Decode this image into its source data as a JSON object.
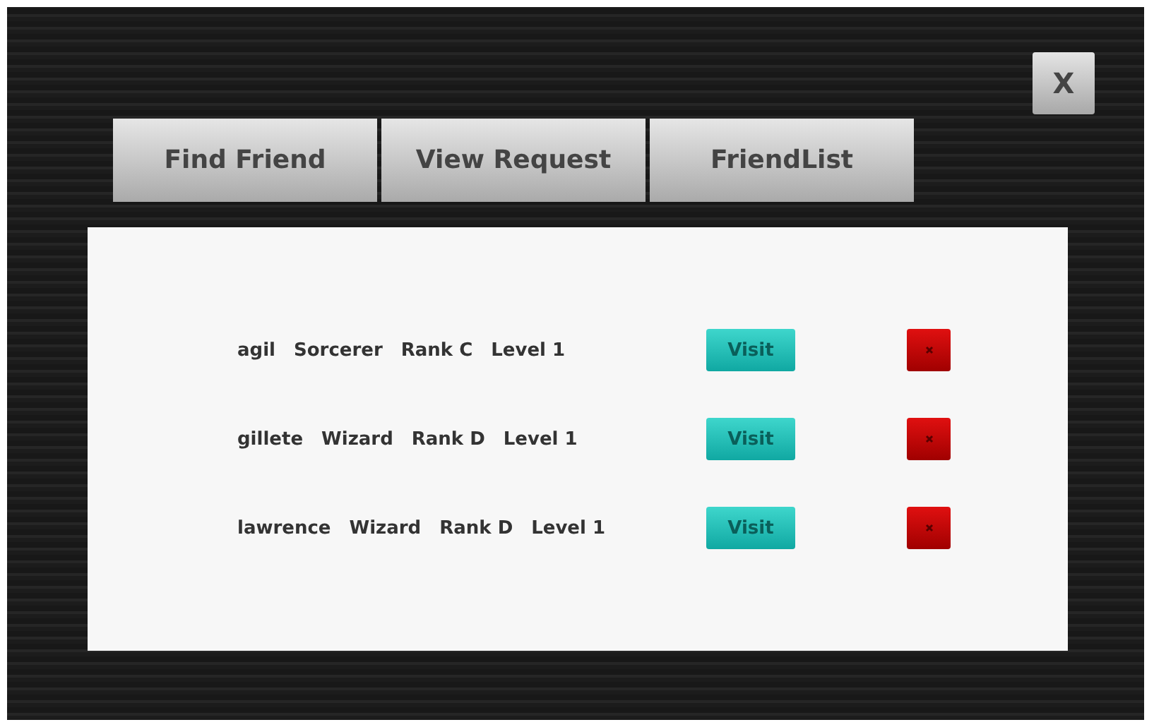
{
  "close_button": {
    "label": "X"
  },
  "tabs": [
    {
      "label": "Find Friend"
    },
    {
      "label": "View Request"
    },
    {
      "label": "FriendList"
    }
  ],
  "friends": [
    {
      "name": "agil",
      "class": "Sorcerer",
      "rank": "Rank C",
      "level": "Level 1",
      "visit": "Visit"
    },
    {
      "name": "gillete",
      "class": "Wizard",
      "rank": "Rank D",
      "level": "Level 1",
      "visit": "Visit"
    },
    {
      "name": "lawrence",
      "class": "Wizard",
      "rank": "Rank D",
      "level": "Level 1",
      "visit": "Visit"
    }
  ]
}
